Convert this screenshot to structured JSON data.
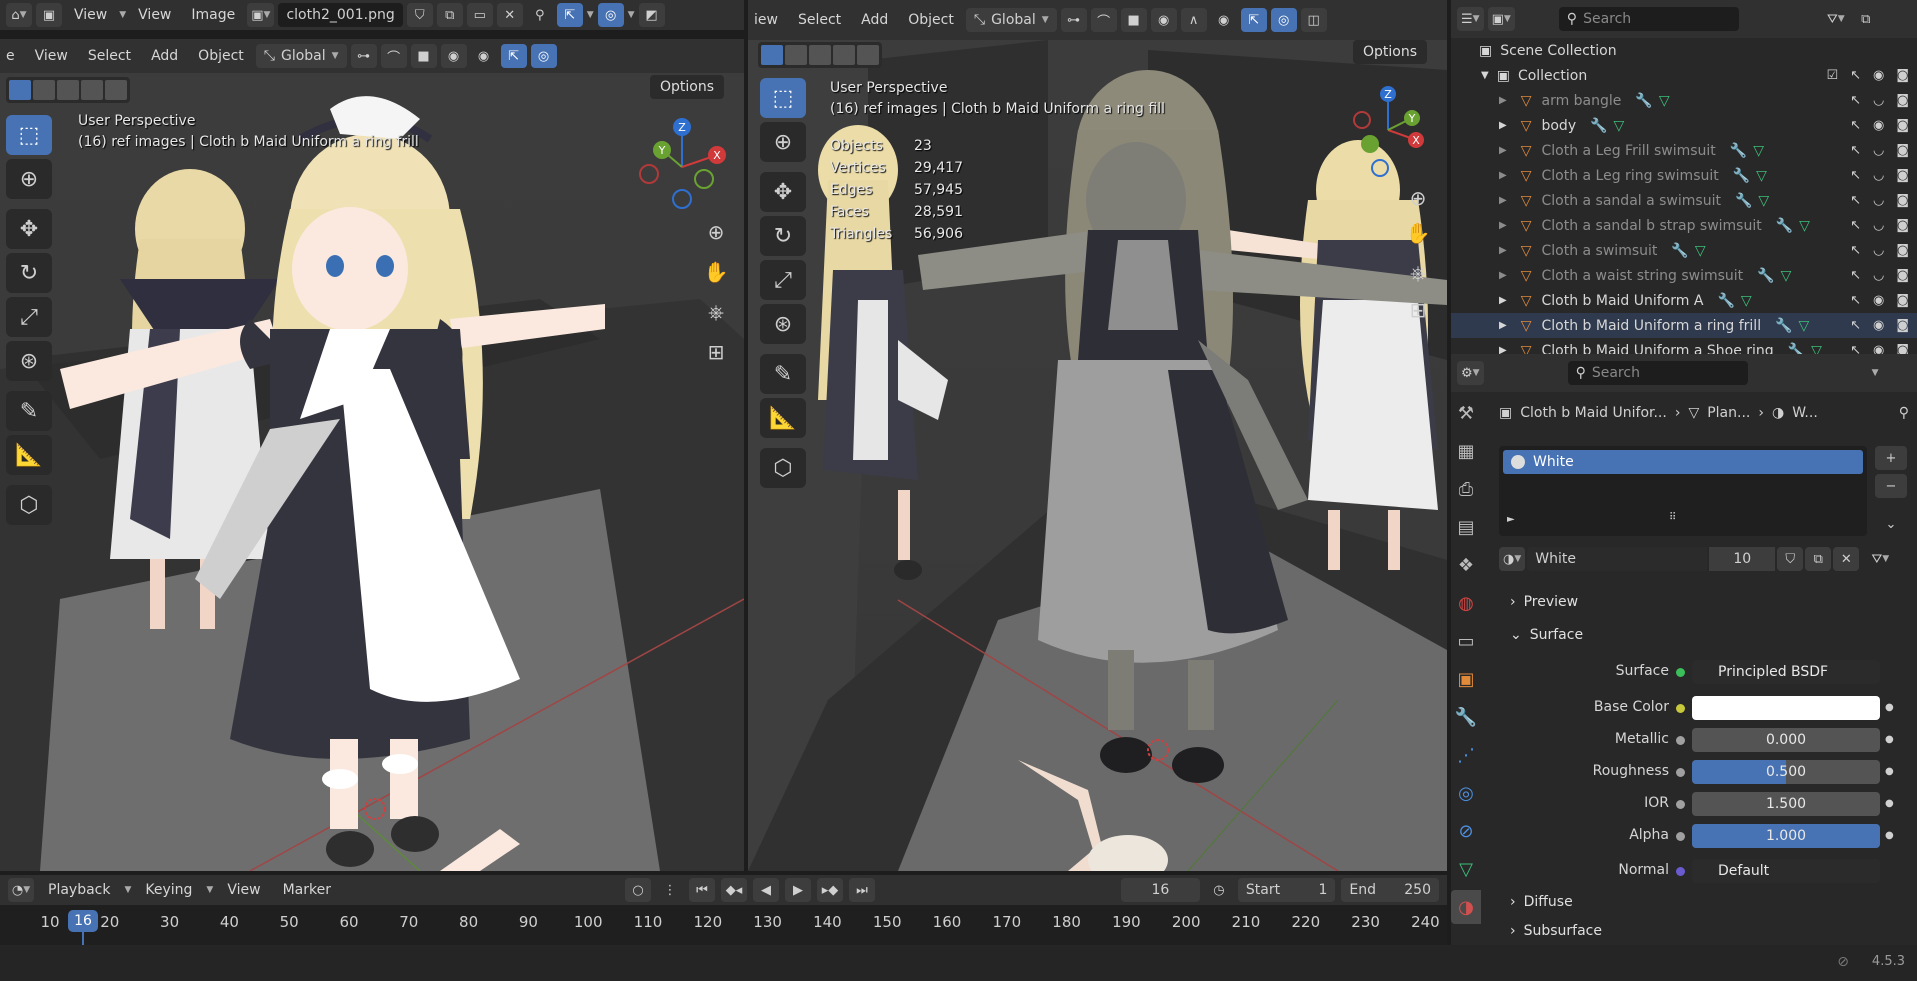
{
  "left_header": {
    "menus": [
      "View",
      "View",
      "Image"
    ],
    "image_name": "cloth2_001.png"
  },
  "left_viewport": {
    "menus": [
      "e",
      "View",
      "Select",
      "Add",
      "Object"
    ],
    "orientation": "Global",
    "options_label": "Options",
    "overlay_title": "User Perspective",
    "overlay_subtitle": "(16) ref images | Cloth b Maid Uniform a ring frill",
    "gizmo": {
      "z": "Z",
      "y": "Y",
      "x": "X"
    }
  },
  "right_viewport": {
    "menus": [
      "iew",
      "Select",
      "Add",
      "Object"
    ],
    "orientation": "Global",
    "options_label": "Options",
    "overlay_title": "User Perspective",
    "overlay_subtitle": "(16) ref images | Cloth b Maid Uniform a ring fill",
    "stats": [
      {
        "key": "Objects",
        "value": "23"
      },
      {
        "key": "Vertices",
        "value": "29,417"
      },
      {
        "key": "Edges",
        "value": "57,945"
      },
      {
        "key": "Faces",
        "value": "28,591"
      },
      {
        "key": "Triangles",
        "value": "56,906"
      }
    ],
    "gizmo": {
      "z": "Z",
      "y": "Y",
      "x": "X"
    }
  },
  "outliner": {
    "search_placeholder": "Search",
    "scene_collection": "Scene Collection",
    "collection": "Collection",
    "items": [
      {
        "label": "arm bangle",
        "dim": true
      },
      {
        "label": "body",
        "dim": false
      },
      {
        "label": "Cloth a Leg Frill swimsuit",
        "dim": true
      },
      {
        "label": "Cloth a Leg ring swimsuit",
        "dim": true
      },
      {
        "label": "Cloth a sandal a swimsuit",
        "dim": true
      },
      {
        "label": "Cloth a sandal b strap swimsuit",
        "dim": true
      },
      {
        "label": "Cloth a swimsuit",
        "dim": true
      },
      {
        "label": "Cloth a waist string swimsuit",
        "dim": true
      },
      {
        "label": "Cloth b Maid Uniform A",
        "dim": false
      },
      {
        "label": "Cloth b Maid Uniform a ring frill",
        "dim": false
      },
      {
        "label": "Cloth b Maid Uniform a Shoe ring",
        "dim": false
      }
    ]
  },
  "properties": {
    "search_placeholder": "Search",
    "breadcrumb": [
      "Cloth b Maid Unifor...",
      "Plan...",
      "W..."
    ],
    "material_slot": "White",
    "material_name": "White",
    "user_count": "10",
    "sections": {
      "preview": "Preview",
      "surface": "Surface",
      "diffuse": "Diffuse",
      "subsurface": "Subsurface"
    },
    "surface_shader": "Principled BSDF",
    "fields": [
      {
        "label": "Base Color",
        "value": "",
        "fraction": 0,
        "color": "#ffffff",
        "dot": "#c8c83c"
      },
      {
        "label": "Metallic",
        "value": "0.000",
        "fraction": 0,
        "dot": "#a0a0a0"
      },
      {
        "label": "Roughness",
        "value": "0.500",
        "fraction": 0.5,
        "dot": "#a0a0a0"
      },
      {
        "label": "IOR",
        "value": "1.500",
        "fraction": 0,
        "dot": "#a0a0a0"
      },
      {
        "label": "Alpha",
        "value": "1.000",
        "fraction": 1,
        "dot": "#a0a0a0"
      }
    ],
    "normal_label": "Normal",
    "normal_value": "Default"
  },
  "timeline": {
    "menus": [
      "Playback",
      "Keying",
      "View",
      "Marker"
    ],
    "current_frame": "16",
    "start_label": "Start",
    "start": "1",
    "end_label": "End",
    "end": "250",
    "ticks": [
      "10",
      "20",
      "30",
      "40",
      "50",
      "60",
      "70",
      "80",
      "90",
      "100",
      "110",
      "120",
      "130",
      "140",
      "150",
      "160",
      "170",
      "180",
      "190",
      "200",
      "210",
      "220",
      "230",
      "240"
    ]
  },
  "status": {
    "version": "4.5.3"
  },
  "colors": {
    "accent": "#4772b3",
    "header": "#303030",
    "panel": "#282828"
  }
}
